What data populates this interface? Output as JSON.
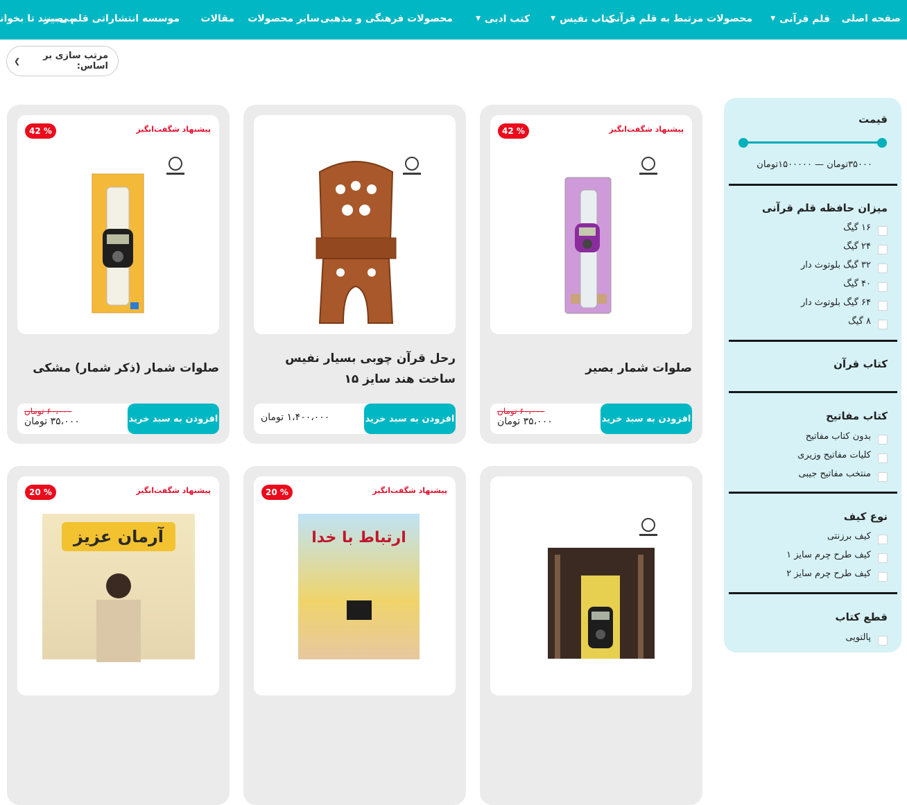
{
  "nav": {
    "items": [
      {
        "label": "صفحه اصلی",
        "caret": false
      },
      {
        "label": "قلم قرآنی",
        "caret": true
      },
      {
        "label": "محصولات مرتبط به قلم قرآنی",
        "caret": false
      },
      {
        "label": "کتاب نفیس",
        "caret": true
      },
      {
        "label": "کتب ادبی",
        "caret": true
      },
      {
        "label": "محصولات فرهنگی و مذهبی",
        "caret": false
      },
      {
        "label": "سایر محصولات",
        "caret": false
      },
      {
        "label": "مقالات",
        "caret": false
      },
      {
        "label": "موسسه انتشاراتی قلم بصیر",
        "caret": false
      },
      {
        "label": "می‌بینند تا بخوانند",
        "caret": false
      }
    ]
  },
  "sort": {
    "label": "مرتب سازی بر اساس:"
  },
  "sidebar": {
    "price": {
      "title": "قیمت",
      "range_text": "۳۵۰۰۰تومان — ۱۵۰۰۰۰۰تومان",
      "min": 35000,
      "max": 1500000
    },
    "memory": {
      "title": "میزان حافظه قلم قرآنی",
      "options": [
        "۱۶ گیگ",
        "۲۴ گیگ",
        "۳۲ گیگ بلوتوث دار",
        "۴۰ گیگ",
        "۶۴ گیگ بلوتوث دار",
        "۸ گیگ"
      ]
    },
    "quran_book": {
      "title": "کتاب قرآن"
    },
    "mafatih": {
      "title": "کتاب مفاتیح",
      "options": [
        "بدون کتاب مفاتیح",
        "کلیات مفاتیح وزیری",
        "منتخب مفاتیح جیبی"
      ]
    },
    "bag": {
      "title": "نوع کیف",
      "options": [
        "کیف برزنتی",
        "کیف طرح چرم سایز ۱",
        "کیف طرح چرم سایز ۲"
      ]
    },
    "book_size": {
      "title": "قطع کتاب",
      "options": [
        "پالتویی"
      ]
    }
  },
  "products": [
    {
      "name": "صلوات شمار بصیر",
      "offer": "پیشنهاد شگفت‌انگیز",
      "discount": "42 %",
      "old_price": "۶۰،۰۰۰ تومان",
      "price": "۳۵،۰۰۰ تومان",
      "buy": "افزودن به سبد خرید"
    },
    {
      "name": "رحل قرآن چوبی بسیار نفیس ساخت هند سایز ۱۵",
      "offer": "",
      "discount": "",
      "old_price": "",
      "price": "۱،۴۰۰،۰۰۰ تومان",
      "buy": "افزودن به سبد خرید"
    },
    {
      "name": "صلوات شمار (ذکر شمار) مشکی",
      "offer": "پیشنهاد شگفت‌انگیز",
      "discount": "42 %",
      "old_price": "۶۰،۰۰۰ تومان",
      "price": "۳۵،۰۰۰ تومان",
      "buy": "افزودن به سبد خرید"
    },
    {
      "name": "",
      "offer": "",
      "discount": "",
      "cover": ""
    },
    {
      "name": "",
      "offer": "پیشنهاد شگفت‌انگیز",
      "discount": "20 %",
      "cover": "ارتباط با خدا"
    },
    {
      "name": "",
      "offer": "پیشنهاد شگفت‌انگیز",
      "discount": "20 %",
      "cover": "آرمان عزیز"
    }
  ],
  "colors": {
    "brand": "#00b7c3",
    "sidebar_bg": "#d6f2f6",
    "discount": "#ea0b1c"
  }
}
